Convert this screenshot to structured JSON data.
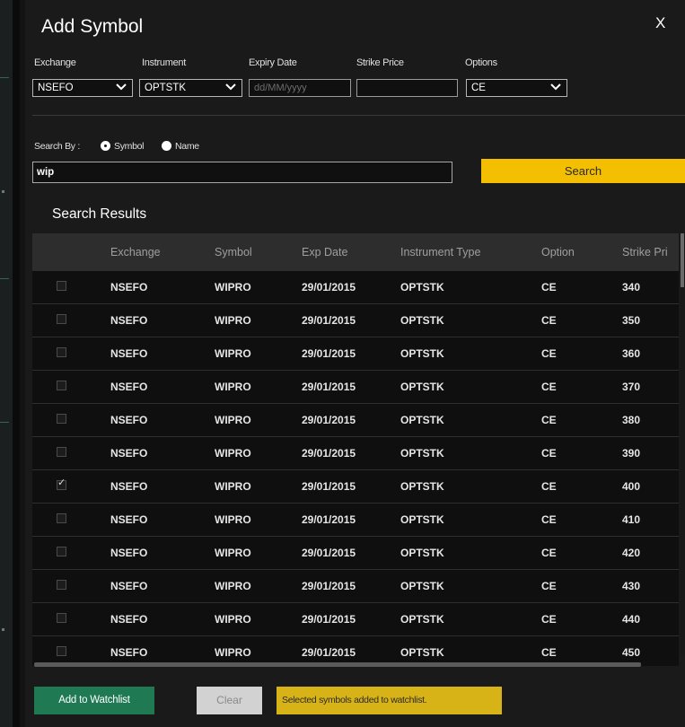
{
  "dialog": {
    "title": "Add Symbol",
    "close_label": "X"
  },
  "filters": {
    "exchange": {
      "label": "Exchange",
      "value": "NSEFO"
    },
    "instrument": {
      "label": "Instrument",
      "value": "OPTSTK"
    },
    "expiry": {
      "label": "Expiry Date",
      "placeholder": "dd/MM/yyyy"
    },
    "strike": {
      "label": "Strike Price",
      "value": ""
    },
    "options": {
      "label": "Options",
      "value": "CE"
    }
  },
  "search": {
    "by_label": "Search By :",
    "option_symbol": "Symbol",
    "option_name": "Name",
    "selected": "Symbol",
    "query": "wip",
    "button_label": "Search"
  },
  "results": {
    "title": "Search Results",
    "columns": [
      "",
      "Exchange",
      "Symbol",
      "Exp Date",
      "Instrument Type",
      "Option",
      "Strike Pri"
    ],
    "rows": [
      {
        "checked": false,
        "exchange": "NSEFO",
        "symbol": "WIPRO",
        "exp_date": "29/01/2015",
        "instrument_type": "OPTSTK",
        "option": "CE",
        "strike": "340"
      },
      {
        "checked": false,
        "exchange": "NSEFO",
        "symbol": "WIPRO",
        "exp_date": "29/01/2015",
        "instrument_type": "OPTSTK",
        "option": "CE",
        "strike": "350"
      },
      {
        "checked": false,
        "exchange": "NSEFO",
        "symbol": "WIPRO",
        "exp_date": "29/01/2015",
        "instrument_type": "OPTSTK",
        "option": "CE",
        "strike": "360"
      },
      {
        "checked": false,
        "exchange": "NSEFO",
        "symbol": "WIPRO",
        "exp_date": "29/01/2015",
        "instrument_type": "OPTSTK",
        "option": "CE",
        "strike": "370"
      },
      {
        "checked": false,
        "exchange": "NSEFO",
        "symbol": "WIPRO",
        "exp_date": "29/01/2015",
        "instrument_type": "OPTSTK",
        "option": "CE",
        "strike": "380"
      },
      {
        "checked": false,
        "exchange": "NSEFO",
        "symbol": "WIPRO",
        "exp_date": "29/01/2015",
        "instrument_type": "OPTSTK",
        "option": "CE",
        "strike": "390"
      },
      {
        "checked": true,
        "exchange": "NSEFO",
        "symbol": "WIPRO",
        "exp_date": "29/01/2015",
        "instrument_type": "OPTSTK",
        "option": "CE",
        "strike": "400"
      },
      {
        "checked": false,
        "exchange": "NSEFO",
        "symbol": "WIPRO",
        "exp_date": "29/01/2015",
        "instrument_type": "OPTSTK",
        "option": "CE",
        "strike": "410"
      },
      {
        "checked": false,
        "exchange": "NSEFO",
        "symbol": "WIPRO",
        "exp_date": "29/01/2015",
        "instrument_type": "OPTSTK",
        "option": "CE",
        "strike": "420"
      },
      {
        "checked": false,
        "exchange": "NSEFO",
        "symbol": "WIPRO",
        "exp_date": "29/01/2015",
        "instrument_type": "OPTSTK",
        "option": "CE",
        "strike": "430"
      },
      {
        "checked": false,
        "exchange": "NSEFO",
        "symbol": "WIPRO",
        "exp_date": "29/01/2015",
        "instrument_type": "OPTSTK",
        "option": "CE",
        "strike": "440"
      },
      {
        "checked": false,
        "exchange": "NSEFO",
        "symbol": "WIPRO",
        "exp_date": "29/01/2015",
        "instrument_type": "OPTSTK",
        "option": "CE",
        "strike": "450"
      }
    ]
  },
  "footer": {
    "add_label": "Add to Watchlist",
    "clear_label": "Clear",
    "status_message": "Selected symbols added to watchlist."
  },
  "icons": {
    "dropdown": "chevron-down-icon",
    "checkbox_mark": "checkmark-icon"
  },
  "colors": {
    "accent": "#f3bf00",
    "add_button": "#1f7a54",
    "status_bg": "#d8b318",
    "dialog_bg": "#1a1a1a"
  }
}
